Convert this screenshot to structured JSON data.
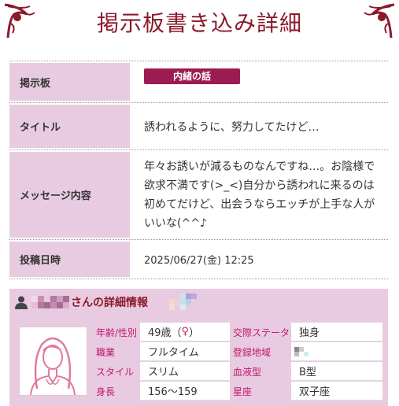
{
  "header": {
    "title": "掲示板書き込み詳細"
  },
  "detail": {
    "board_label": "掲示板",
    "board_value": "内緒の話",
    "title_label": "タイトル",
    "title_value": "誘われるように、努力してたけど…",
    "message_label": "メッセージ内容",
    "message_value": "年々お誘いが減るものなんですね…。お陰様で欲求不満です(>_<)自分から誘われに来るのは初めてだけど、出会うならエッチが上手な人がいいな(^^♪",
    "date_label": "投稿日時",
    "date_value": "2025/06/27(金) 12:25"
  },
  "profile": {
    "title_suffix": "さんの詳細情報",
    "icon": "person-icon",
    "avatar_icon": "female-avatar-icon",
    "fields": [
      {
        "label": "年齢/性別",
        "value": "49歳（",
        "symbol": "♀",
        "value_end": "）",
        "label2": "交際ステータス",
        "value2": "独身"
      },
      {
        "label": "職業",
        "value": "フルタイム",
        "label2": "登録地域",
        "value2": ""
      },
      {
        "label": "スタイル",
        "value": "スリム",
        "label2": "血液型",
        "value2": "B型"
      },
      {
        "label": "身長",
        "value": "156〜159",
        "label2": "星座",
        "value2": "双子座"
      }
    ]
  },
  "colors": {
    "accent": "#8b1a2b",
    "label_bg": "#e8cbe1",
    "badge": "#9b1c52",
    "field_label": "#c0186a"
  }
}
